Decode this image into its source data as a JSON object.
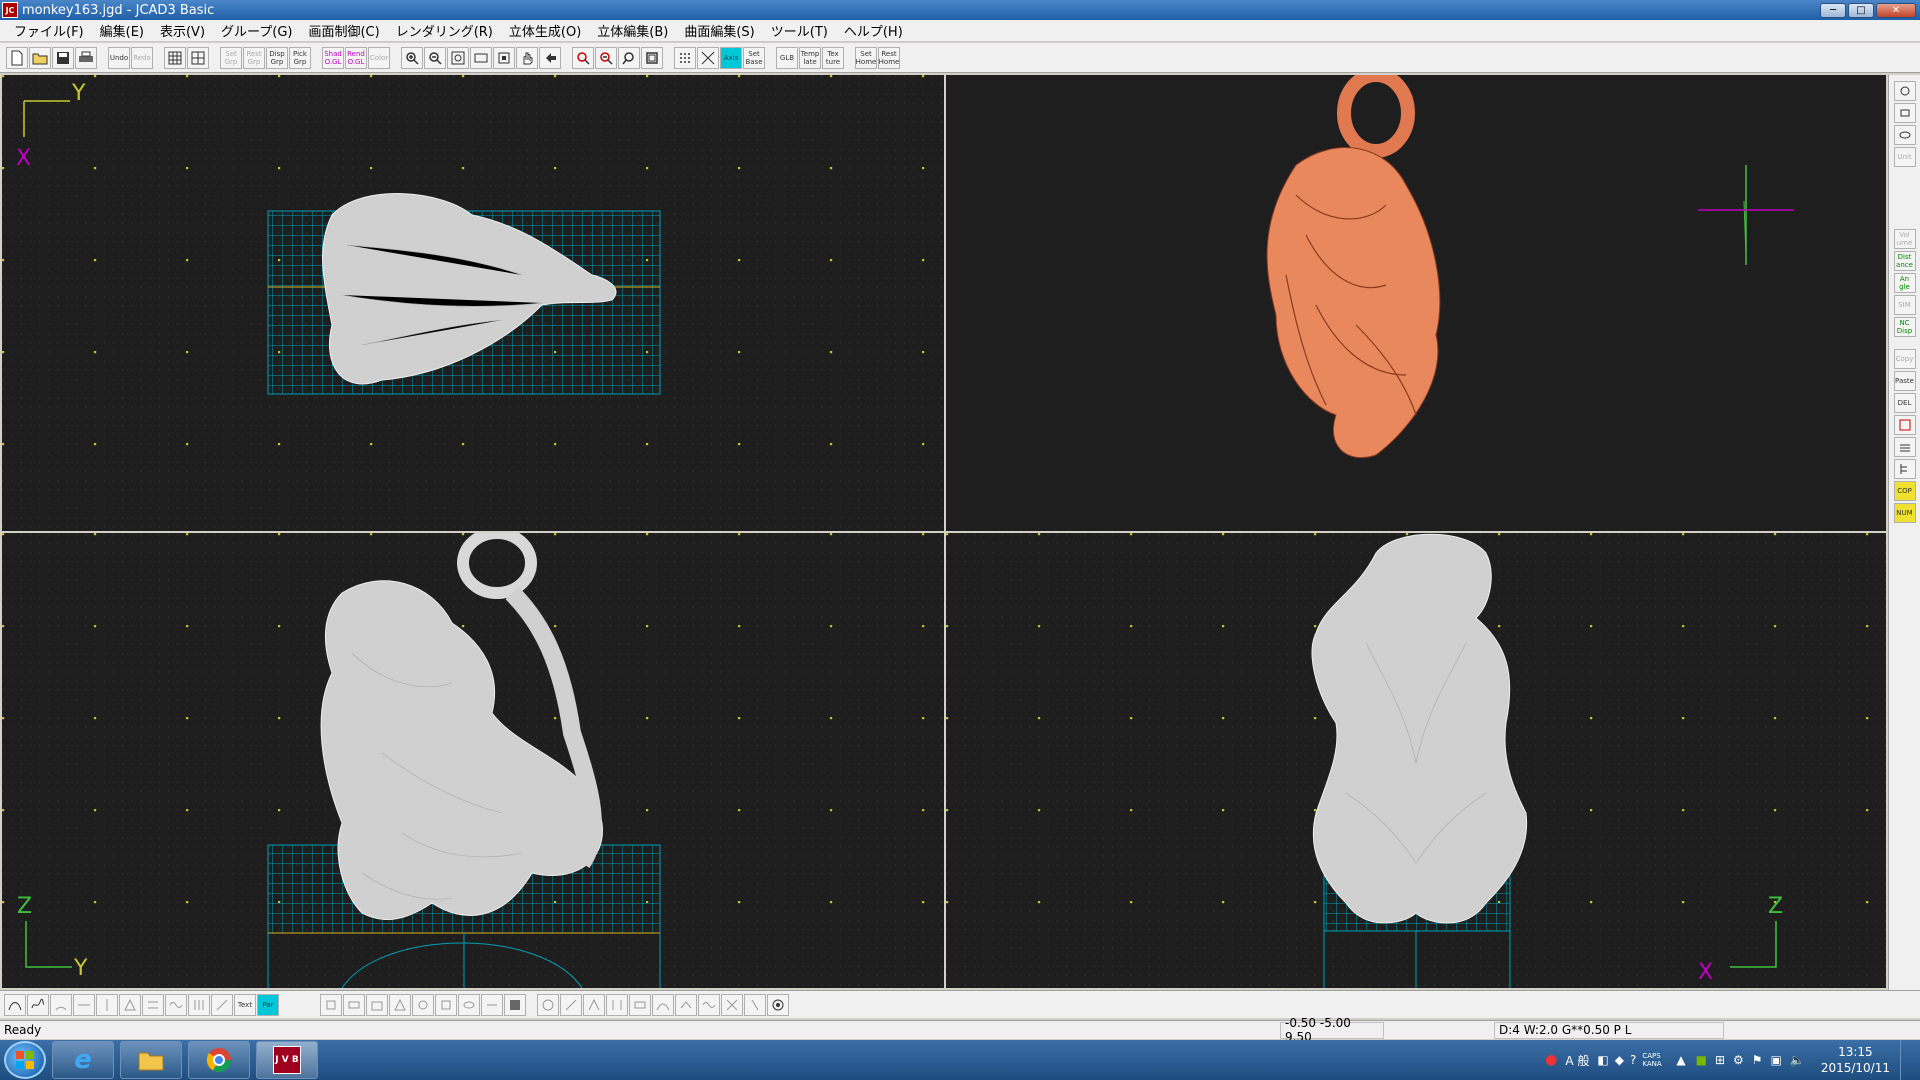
{
  "window": {
    "title": "monkey163.jgd - JCAD3 Basic",
    "app_icon_label": "JC"
  },
  "window_controls": {
    "minimize": "─",
    "maximize": "□",
    "close": "✕"
  },
  "menu": [
    "ファイル(F)",
    "編集(E)",
    "表示(V)",
    "グループ(G)",
    "画面制御(C)",
    "レンダリング(R)",
    "立体生成(O)",
    "立体編集(B)",
    "曲面編集(S)",
    "ツール(T)",
    "ヘルプ(H)"
  ],
  "toolbar": {
    "group1": [
      "new-icon",
      "open-icon",
      "save-icon",
      "print-icon"
    ],
    "undo": "Undo",
    "redo": "Redo",
    "group2": [
      "grid-icon",
      "split-icon"
    ],
    "set_grp": "Set Grp",
    "rest_grp": "Rest Grp",
    "disp_grp": "Disp Grp",
    "pick_grp": "Pick Grp",
    "shad": "Shad O.GL",
    "rend": "Rend O.GL",
    "color": "Color",
    "group3": [
      "zoom-in-icon",
      "zoom-out-icon",
      "zoom-window-icon",
      "zoom-all-icon",
      "fit-icon",
      "pan-icon",
      "back-icon"
    ],
    "group4": [
      "zoom-in2-icon",
      "zoom-out2-icon",
      "zoom-sel-icon",
      "zoom-frame-icon"
    ],
    "grid_dots": "grid-dots-icon",
    "snap": "snap-icon",
    "axis": "Axis",
    "set_base": "Set Base",
    "glb": "GLB",
    "template": "Temp late",
    "texture": "Tex ture",
    "set_home": "Set Home",
    "rest_home": "Rest Home"
  },
  "views": {
    "top": {
      "axis_h": "Y",
      "axis_v": "X"
    },
    "front": {
      "axis_h": "Y",
      "axis_v": "Z"
    },
    "side": {
      "axis_h": "X",
      "axis_v": "Z"
    }
  },
  "right_toolbar": [
    "Vol ume",
    "Dist ance",
    "An gle",
    "SIM",
    "NC Disp",
    "Copy",
    "Paste",
    "DEL",
    "COP",
    "NUM",
    "Unit"
  ],
  "bottom_toolbar": {
    "text_btn": "Text",
    "par_btn": "Par"
  },
  "status": {
    "text": "Ready",
    "coords": "-0.50 -5.00 9.50",
    "info": "D:4 W:2.0  G**0.50 P   L"
  },
  "taskbar": {
    "time": "13:15",
    "date": "2015/10/11",
    "ime": "A 般",
    "caps": "CAPS KANA",
    "jvb": "J V B"
  },
  "colors": {
    "accent": "#00c8d8",
    "viewport_bg": "#1e1e1e",
    "grid_dot": "#c8c832",
    "mesh": "#00b0c8",
    "wire": "#d8d8d8",
    "render": "#f08050"
  }
}
